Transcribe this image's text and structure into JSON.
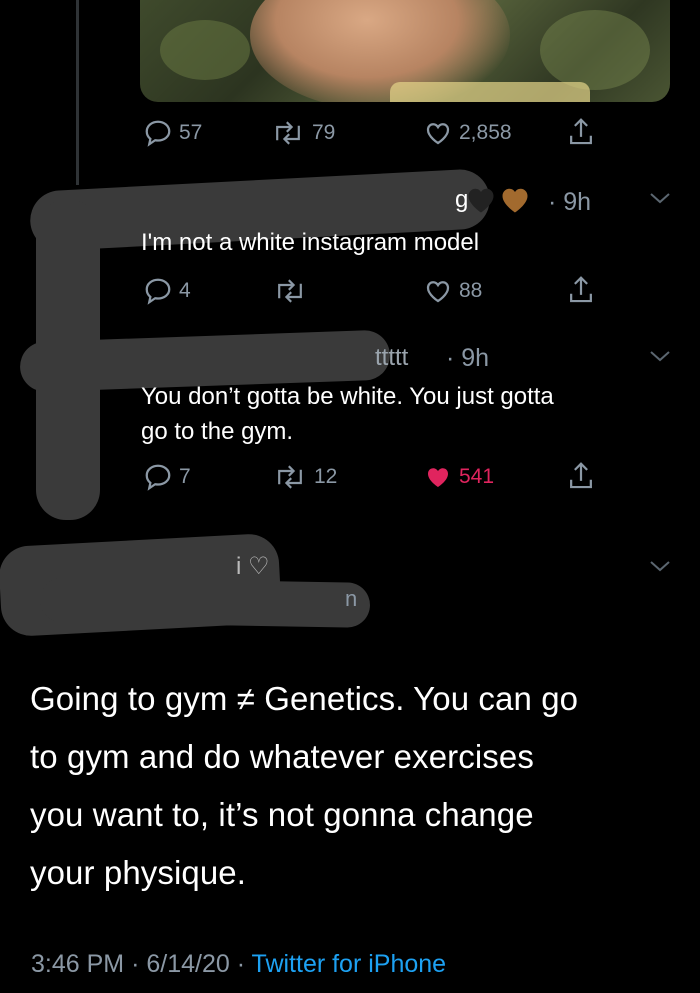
{
  "top_tweet": {
    "replies": "57",
    "retweets": "79",
    "likes": "2,858"
  },
  "reply1": {
    "name_fragment": "g",
    "hearts": "🖤🧡",
    "time": "· 9h",
    "text": "I'm not a white instagram model",
    "replies": "4",
    "retweets": "",
    "likes": "88"
  },
  "reply2": {
    "name_fragment": "ttttt",
    "time": "· 9h",
    "text_line1": "You don’t gotta be white. You just gotta",
    "text_line2": "go to the gym.",
    "replies": "7",
    "retweets": "12",
    "likes": "541"
  },
  "main_tweet": {
    "name_fragment": "i ♡",
    "handle_fragment": "n",
    "line1": "Going to gym ≠ Genetics. You can go",
    "line2": "to gym and do whatever exercises",
    "line3": "you want to, it’s not gonna change",
    "line4": "your physique.",
    "time": "3:46 PM",
    "date": "6/14/20",
    "source": "Twitter for iPhone",
    "sep": "·"
  },
  "colors": {
    "background": "#000000",
    "muted": "#8b98a5",
    "like": "#e0245e",
    "link": "#1da1f2"
  }
}
